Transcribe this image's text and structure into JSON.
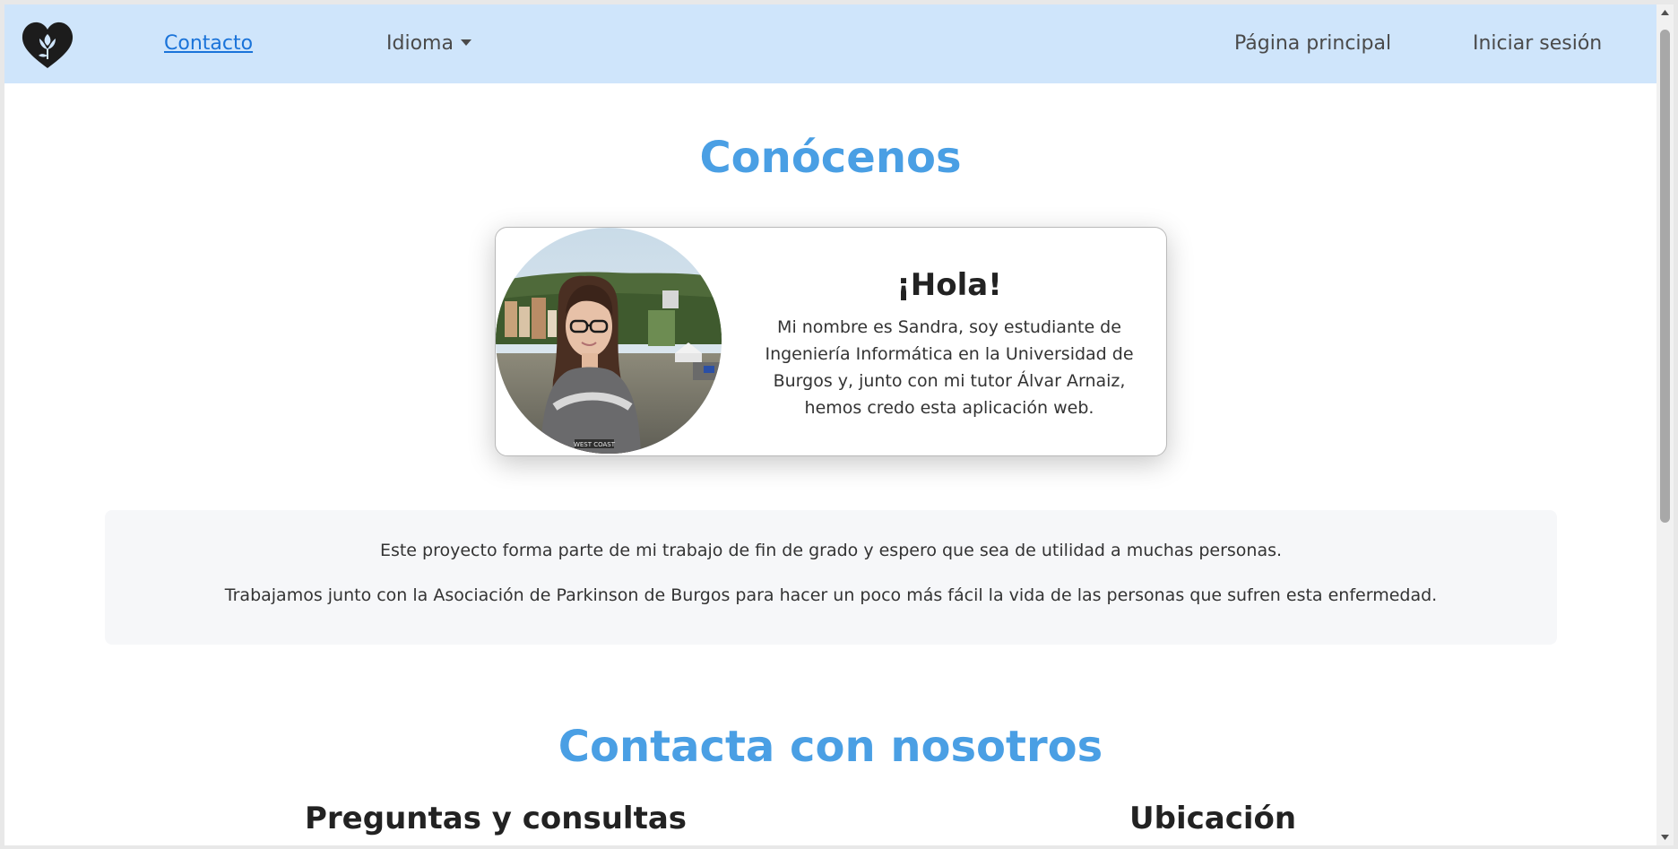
{
  "navbar": {
    "logo_icon": "heart-flower-logo",
    "links": {
      "contacto": "Contacto",
      "idioma": "Idioma",
      "home": "Página principal",
      "login": "Iniciar sesión"
    }
  },
  "about": {
    "title": "Conócenos",
    "card": {
      "heading": "¡Hola!",
      "text": "Mi nombre es Sandra, soy estudiante de Ingeniería Informática en la Universidad de Burgos y, junto con mi tutor Álvar Arnaiz, hemos credo esta aplicación web.",
      "photo_shirt_text": "WEST COAST"
    }
  },
  "info": {
    "line1": "Este proyecto forma parte de mi trabajo de fin de grado y espero que sea de utilidad a muchas personas.",
    "line2": "Trabajamos junto con la Asociación de Parkinson de Burgos para hacer un poco más fácil la vida de las personas que sufren esta enfermedad."
  },
  "contact": {
    "title": "Contacta con nosotros",
    "questions_heading": "Preguntas y consultas",
    "location_heading": "Ubicación"
  },
  "colors": {
    "navbar_bg": "#cfe5fb",
    "title_blue": "#4a9fe4",
    "link_blue": "#1a73d9",
    "info_bg": "#f6f7f9"
  }
}
